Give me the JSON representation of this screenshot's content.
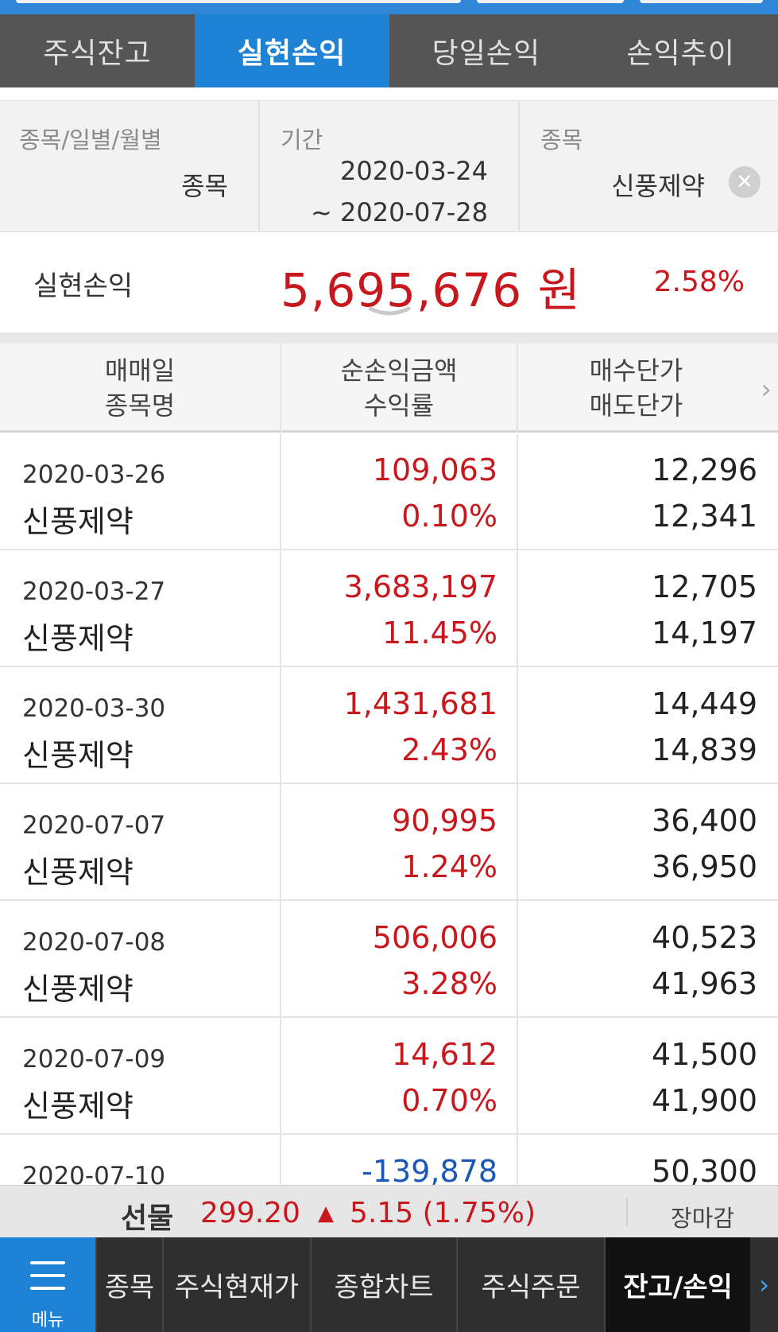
{
  "tabs": [
    {
      "label": "주식잔고"
    },
    {
      "label": "실현손익"
    },
    {
      "label": "당일손익"
    },
    {
      "label": "손익추이"
    }
  ],
  "filters": {
    "type_label": "종목/일별/월별",
    "type_value": "종목",
    "period_label": "기간",
    "period_start": "2020-03-24",
    "period_end": "~ 2020-07-28",
    "stock_label": "종목",
    "stock_value": "신풍제약"
  },
  "summary": {
    "label": "실현손익",
    "amount": "5,695,676 원",
    "rate": "2.58%"
  },
  "table": {
    "headers": [
      {
        "line1": "매매일",
        "line2": "종목명"
      },
      {
        "line1": "순손익금액",
        "line2": "수익률"
      },
      {
        "line1": "매수단가",
        "line2": "매도단가"
      }
    ],
    "rows": [
      {
        "date": "2020-03-26",
        "name": "신풍제약",
        "amount": "109,063",
        "rate": "0.10%",
        "buy": "12,296",
        "sell": "12,341"
      },
      {
        "date": "2020-03-27",
        "name": "신풍제약",
        "amount": "3,683,197",
        "rate": "11.45%",
        "buy": "12,705",
        "sell": "14,197"
      },
      {
        "date": "2020-03-30",
        "name": "신풍제약",
        "amount": "1,431,681",
        "rate": "2.43%",
        "buy": "14,449",
        "sell": "14,839"
      },
      {
        "date": "2020-07-07",
        "name": "신풍제약",
        "amount": "90,995",
        "rate": "1.24%",
        "buy": "36,400",
        "sell": "36,950"
      },
      {
        "date": "2020-07-08",
        "name": "신풍제약",
        "amount": "506,006",
        "rate": "3.28%",
        "buy": "40,523",
        "sell": "41,963"
      },
      {
        "date": "2020-07-09",
        "name": "신풍제약",
        "amount": "14,612",
        "rate": "0.70%",
        "buy": "41,500",
        "sell": "41,900"
      },
      {
        "date": "2020-07-10",
        "name": "",
        "amount": "-139,878",
        "rate": "",
        "buy": "50,300",
        "sell": ""
      }
    ]
  },
  "ticker": {
    "name": "선물",
    "price": "299.20",
    "arrow": "▲",
    "change": "5.15 (1.75%)",
    "status": "장마감"
  },
  "bottom_nav": {
    "menu_label": "메뉴",
    "items": [
      {
        "label": "종목"
      },
      {
        "label": "주식현재가"
      },
      {
        "label": "종합차트"
      },
      {
        "label": "주식주문"
      },
      {
        "label": "잔고/손익"
      }
    ],
    "more": "›"
  },
  "colors": {
    "accent": "#1f83d5",
    "positive": "#c8181e",
    "negative": "#1b57b8",
    "tab_bg": "#555555",
    "nav_bg": "#2f2f2f"
  }
}
